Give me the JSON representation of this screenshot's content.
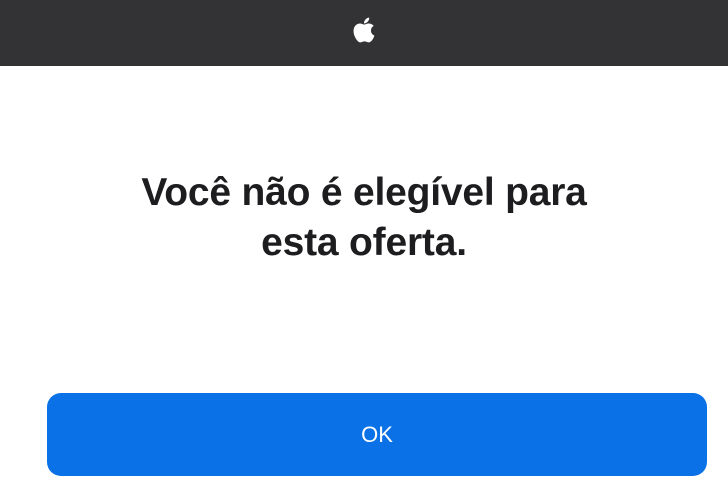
{
  "header": {
    "logo_icon": "apple-logo-icon"
  },
  "dialog": {
    "message_line1": "Você não é elegível para",
    "message_line2": "esta oferta.",
    "ok_label": "OK"
  },
  "colors": {
    "topbar": "#333335",
    "background": "#ffffff",
    "text": "#1d1d1f",
    "button": "#0a71e6",
    "button_text": "#ffffff"
  }
}
